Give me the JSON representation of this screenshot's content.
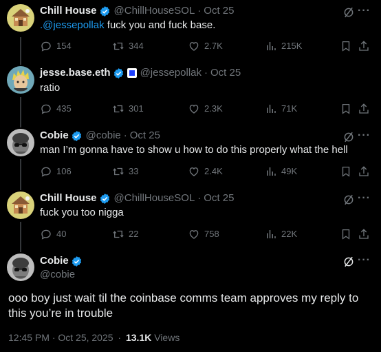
{
  "tweets": [
    {
      "name": "Chill House",
      "handle": "@ChillHouseSOL",
      "time": "Oct 25",
      "mention": ".@jessepollak",
      "text": " fuck you and fuck base.",
      "replies": "154",
      "reposts": "344",
      "likes": "2.7K",
      "views": "215K"
    },
    {
      "name": "jesse.base.eth",
      "handle": "@jessepollak",
      "time": "Oct 25",
      "text": "ratio",
      "replies": "435",
      "reposts": "301",
      "likes": "2.3K",
      "views": "71K"
    },
    {
      "name": "Cobie",
      "handle": "@cobie",
      "time": "Oct 25",
      "text": "man I’m gonna have to show u how to do this properly what the hell",
      "replies": "106",
      "reposts": "33",
      "likes": "2.4K",
      "views": "49K"
    },
    {
      "name": "Chill House",
      "handle": "@ChillHouseSOL",
      "time": "Oct 25",
      "text": "fuck you too nigga",
      "replies": "40",
      "reposts": "22",
      "likes": "758",
      "views": "22K"
    }
  ],
  "main": {
    "name": "Cobie",
    "handle": "@cobie",
    "text": "ooo boy just wait til the coinbase comms team approves my reply to this you’re in trouble",
    "timestamp": "12:45 PM · Oct 25, 2025",
    "views_count": "13.1K",
    "views_label": "Views"
  },
  "ui": {
    "separator": "·",
    "more": "···"
  },
  "colors": {
    "accent": "#1d9bf0",
    "muted": "#71767b",
    "text": "#e7e9ea",
    "background": "#000000"
  }
}
